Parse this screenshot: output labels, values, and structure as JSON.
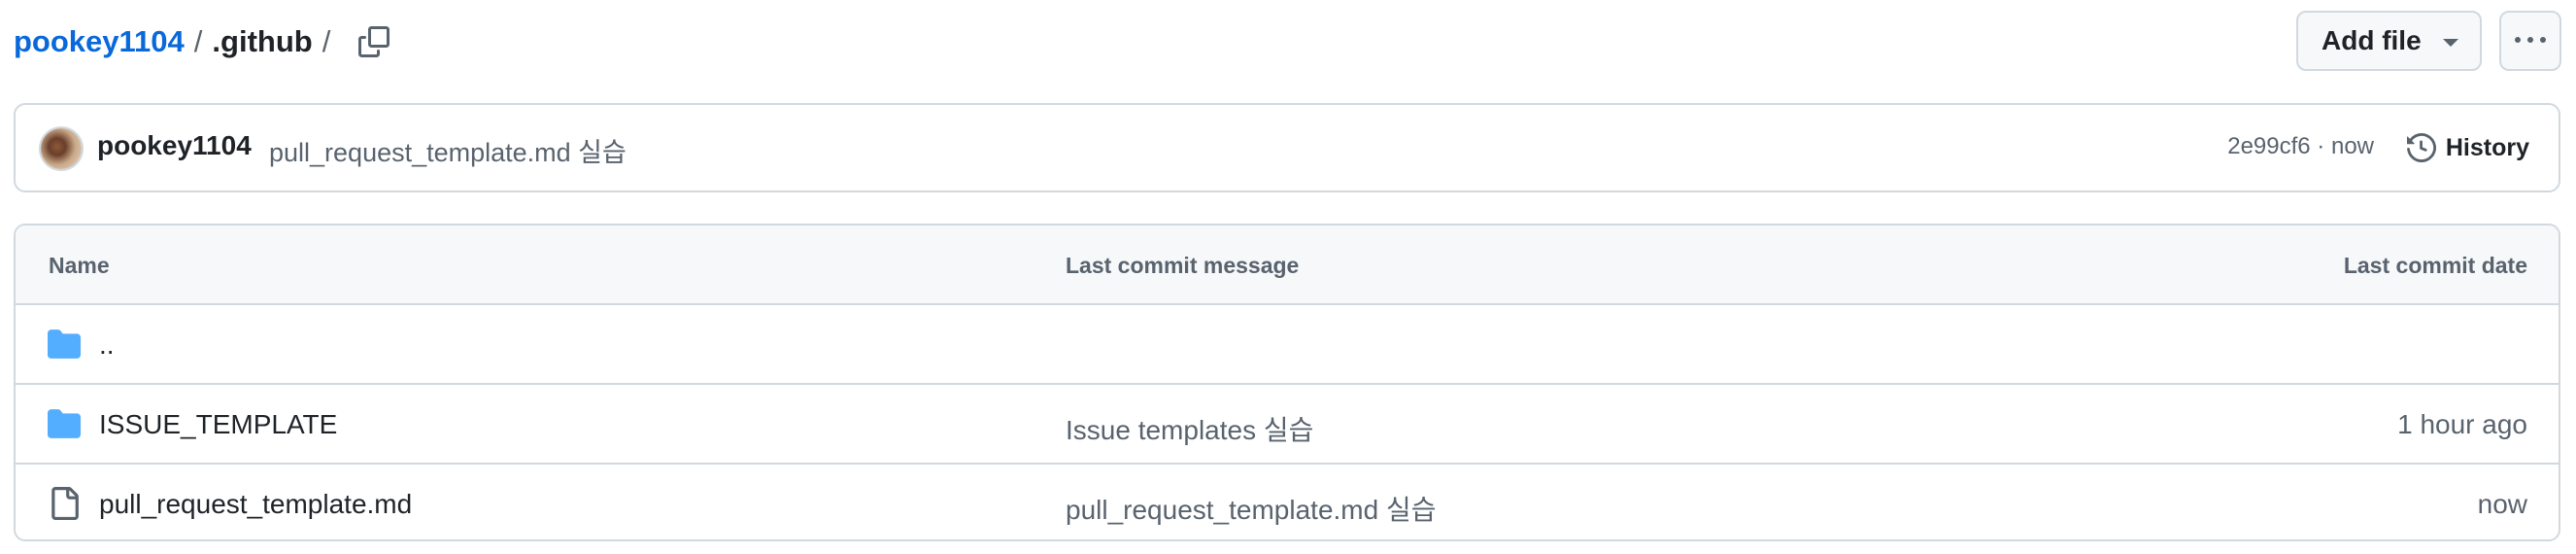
{
  "breadcrumb": {
    "owner": "pookey1104",
    "separator": "/",
    "directory": ".github",
    "trailing_separator": "/"
  },
  "actions": {
    "add_file_label": "Add file",
    "more_icon": "kebab-horizontal-icon",
    "copy_icon": "copy-icon"
  },
  "latest_commit": {
    "author": "pookey1104",
    "message": "pull_request_template.md 실습",
    "sha": "2e99cf6",
    "separator": "·",
    "time": "now",
    "history_label": "History",
    "history_icon": "history-icon"
  },
  "table": {
    "columns": {
      "name": "Name",
      "message": "Last commit message",
      "date": "Last commit date"
    },
    "rows": [
      {
        "type": "parent-directory",
        "icon": "folder-icon",
        "name": "..",
        "message": "",
        "date": ""
      },
      {
        "type": "directory",
        "icon": "folder-icon",
        "name": "ISSUE_TEMPLATE",
        "message": "Issue templates 실습",
        "date": "1 hour ago"
      },
      {
        "type": "file",
        "icon": "file-icon",
        "name": "pull_request_template.md",
        "message": "pull_request_template.md 실습",
        "date": "now"
      }
    ]
  },
  "colors": {
    "link": "#0969da",
    "folder": "#54aeff",
    "border": "#d1d9e0",
    "muted_text": "#59636e",
    "header_bg": "#f6f8fa"
  }
}
